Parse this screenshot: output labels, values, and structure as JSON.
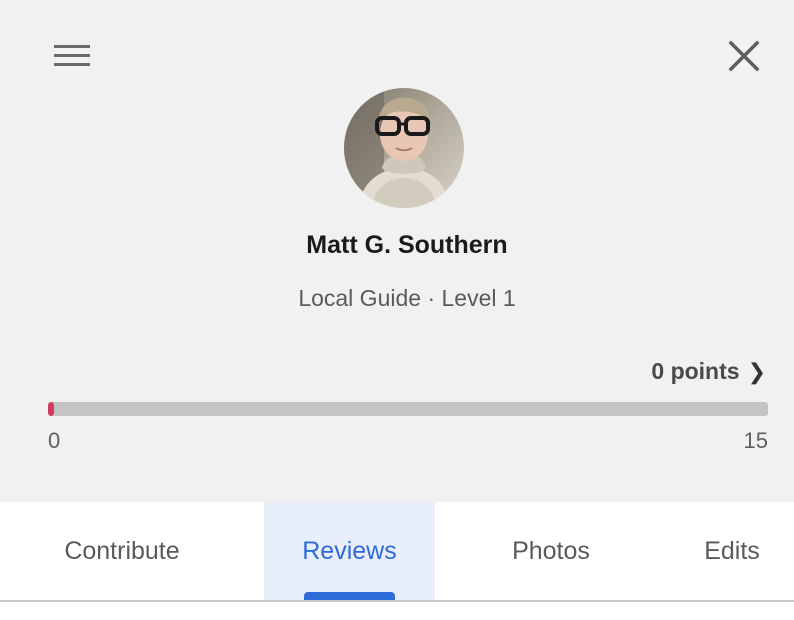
{
  "profile": {
    "name": "Matt G. Southern",
    "level_text": "Local Guide · Level 1",
    "points_label": "0 points",
    "avatar_icon": "profile-photo"
  },
  "progress": {
    "min_label": "0",
    "max_label": "15",
    "current": 0,
    "max": 15,
    "fill_color": "#d23d5e",
    "track_color": "#c4c4c4"
  },
  "tabs": [
    {
      "label": "Contribute",
      "active": false
    },
    {
      "label": "Reviews",
      "active": true
    },
    {
      "label": "Photos",
      "active": false
    },
    {
      "label": "Edits",
      "active": false
    }
  ],
  "icons": {
    "menu": "menu-icon",
    "close": "close-icon",
    "chevron": "chevron-right-icon"
  },
  "colors": {
    "accent": "#2f6bd6",
    "header_bg": "#f1f1f1"
  }
}
